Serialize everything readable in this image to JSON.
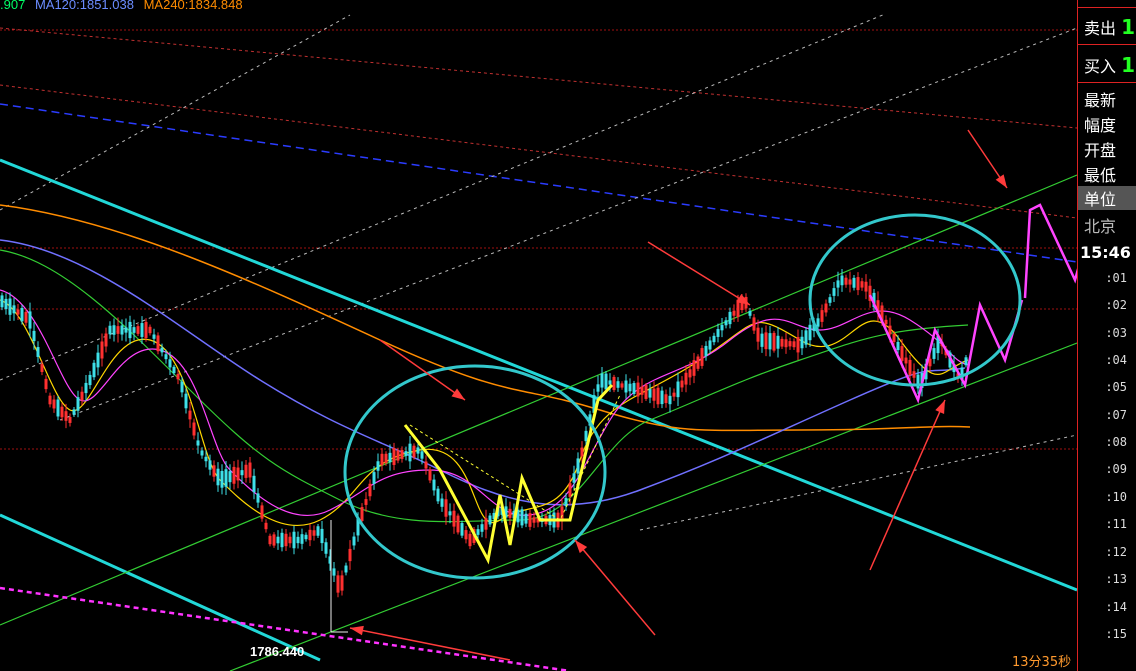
{
  "legend": {
    "ma_partial": ".907",
    "ma120": "MA120:1851.038",
    "ma240": "MA240:1834.848",
    "colors": {
      "ma_partial": "#00ff66",
      "ma120": "#6b8cff",
      "ma240": "#ff8c00"
    }
  },
  "side_panel": {
    "sell_label": "卖出",
    "sell_value": "1",
    "buy_label": "买入",
    "buy_value": "1",
    "fields": [
      "最新",
      "幅度",
      "开盘",
      "最低",
      "单位",
      "北京"
    ],
    "time": "15:46",
    "ticks": [
      ":01",
      ":02",
      ":03",
      ":04",
      ":05",
      ":07",
      ":08",
      ":09",
      ":10",
      ":11",
      ":12",
      ":13",
      ":14",
      ":15"
    ]
  },
  "chart_data": {
    "type": "line",
    "price_label": "1786.440",
    "countdown": "13分35秒",
    "colors": {
      "candle_up": "#ff3030",
      "candle_down": "#3ee0e8",
      "trend": "#22d8d8",
      "channel": "#33cc33",
      "ma_fast": "#ffd700",
      "ma_mid": "#ff44ff",
      "ma120": "#7070ff",
      "ma240": "#ff8c00",
      "annotation_zigzag": "#ffff33",
      "projection": "#ff44ff",
      "arrow": "#ff3b3b",
      "circle": "#33c8cc"
    }
  }
}
